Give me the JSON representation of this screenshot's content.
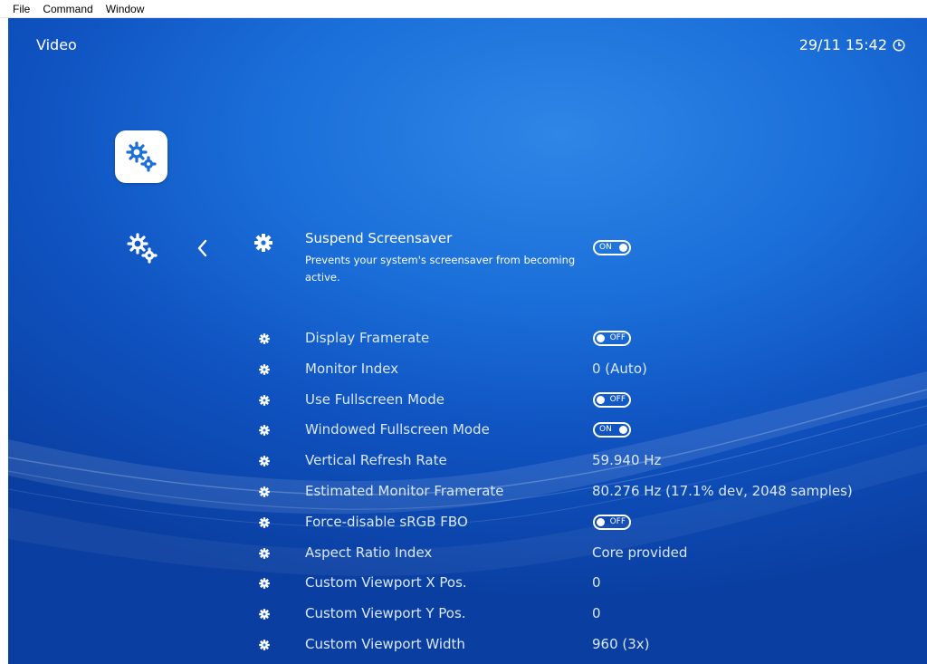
{
  "menubar": {
    "file": "File",
    "command": "Command",
    "window": "Window"
  },
  "header": {
    "title": "Video",
    "clock": "29/11 15:42"
  },
  "colors": {
    "background": "#1b6fd9",
    "text": "#ffffff"
  },
  "selected": {
    "label": "Suspend Screensaver",
    "description": "Prevents your system's screensaver from becoming active.",
    "toggle": "ON"
  },
  "settings": [
    {
      "label": "Display Framerate",
      "toggle": "OFF"
    },
    {
      "label": "Monitor Index",
      "value": "0 (Auto)"
    },
    {
      "label": "Use Fullscreen Mode",
      "toggle": "OFF"
    },
    {
      "label": "Windowed Fullscreen Mode",
      "toggle": "ON"
    },
    {
      "label": "Vertical Refresh Rate",
      "value": "59.940 Hz"
    },
    {
      "label": "Estimated Monitor Framerate",
      "value": "80.276 Hz (17.1% dev, 2048 samples)"
    },
    {
      "label": "Force-disable sRGB FBO",
      "toggle": "OFF"
    },
    {
      "label": "Aspect Ratio Index",
      "value": "Core provided"
    },
    {
      "label": "Custom Viewport X Pos.",
      "value": "0"
    },
    {
      "label": "Custom Viewport Y Pos.",
      "value": "0"
    },
    {
      "label": "Custom Viewport Width",
      "value": "960 (3x)"
    }
  ]
}
